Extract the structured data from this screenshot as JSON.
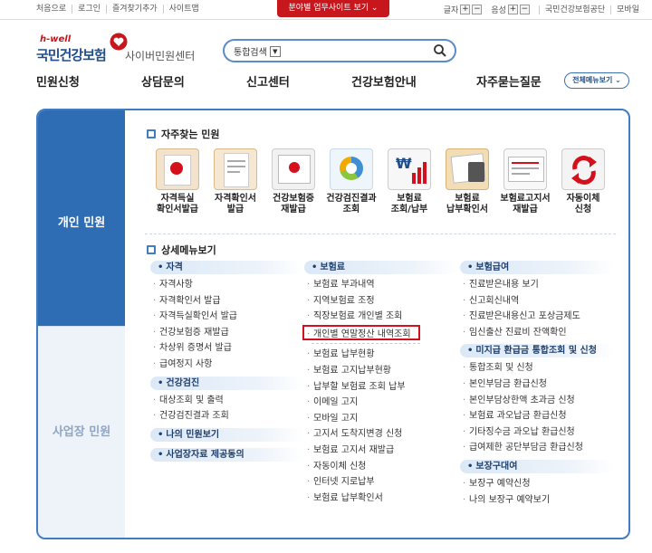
{
  "top": {
    "links": [
      "처음으로",
      "로그인",
      "즐겨찾기추가",
      "사이트맵"
    ],
    "red_tab": "분야별 업무사이트 보기",
    "text_size_label": "글자",
    "volume_label": "음성",
    "right_links": [
      "국민건강보험공단",
      "모바일"
    ],
    "plus": "+",
    "minus": "−"
  },
  "logo": {
    "hwell": "h-well",
    "name": "국민건강보험",
    "center": "사이버민원센터"
  },
  "search": {
    "select_value": "통합검색"
  },
  "gnb": [
    "민원신청",
    "상담문의",
    "신고센터",
    "건강보험안내",
    "자주묻는질문"
  ],
  "all_menu": "전체메뉴보기",
  "sidebar": {
    "tab_personal": "개인 민원",
    "tab_business": "사업장 민원"
  },
  "favorites": {
    "title": "자주찾는 민원",
    "items": [
      {
        "l1": "자격득실",
        "l2": "확인서발급"
      },
      {
        "l1": "자격확인서",
        "l2": "발급"
      },
      {
        "l1": "건강보험증",
        "l2": "재발급"
      },
      {
        "l1": "건강검진결과",
        "l2": "조회"
      },
      {
        "l1": "보험료",
        "l2": "조회/납부"
      },
      {
        "l1": "보험료",
        "l2": "납부확인서"
      },
      {
        "l1": "보험료고지서",
        "l2": "재발급"
      },
      {
        "l1": "자동이체",
        "l2": "신청"
      }
    ]
  },
  "detail": {
    "title": "상세메뉴보기",
    "col1": {
      "cat1": "자격",
      "cat1_items": [
        "자격사항",
        "자격확인서 발급",
        "자격득실확인서 발급",
        "건강보험증 재발급",
        "차상위 증명서 발급",
        "급여정지 사항"
      ],
      "cat2": "건강검진",
      "cat2_items": [
        "대상조회 및 출력",
        "건강검진결과 조회"
      ],
      "cat3": "나의 민원보기",
      "cat4": "사업장자료 제공동의"
    },
    "col2": {
      "cat1": "보험료",
      "items_a": [
        "보험료 부과내역",
        "지역보험료 조정",
        "직장보험료 개인별 조회"
      ],
      "highlight": "개인별 연말정산 내역조회",
      "items_b": [
        "보험료 납부현황",
        "보험료 고지납부현황",
        "납부할 보험료 조회 납부",
        "이메일 고지",
        "모바일 고지",
        "고지서 도착지변경 신청",
        "보험료 고지서 재발급",
        "자동이체 신청",
        "인터넷 지로납부",
        "보험료 납부확인서"
      ]
    },
    "col3": {
      "cat1": "보험급여",
      "cat1_items": [
        "진료받은내용 보기",
        "신고회신내역",
        "진료받은내용신고 포상금제도",
        "임신출산 진료비 잔액확인"
      ],
      "cat2": "미지급 환급금 통합조회 및 신청",
      "cat2_items": [
        "통합조회 및 신청",
        "본인부담금 환급신청",
        "본인부담상한액 초과금 신청",
        "보험료 과오납금 환급신청",
        "기타징수금 과오납 환급신청",
        "급여제한 공단부담금 환급신청"
      ],
      "cat3": "보장구대여",
      "cat3_items": [
        "보장구 예약신청",
        "나의 보장구 예약보기"
      ]
    }
  }
}
